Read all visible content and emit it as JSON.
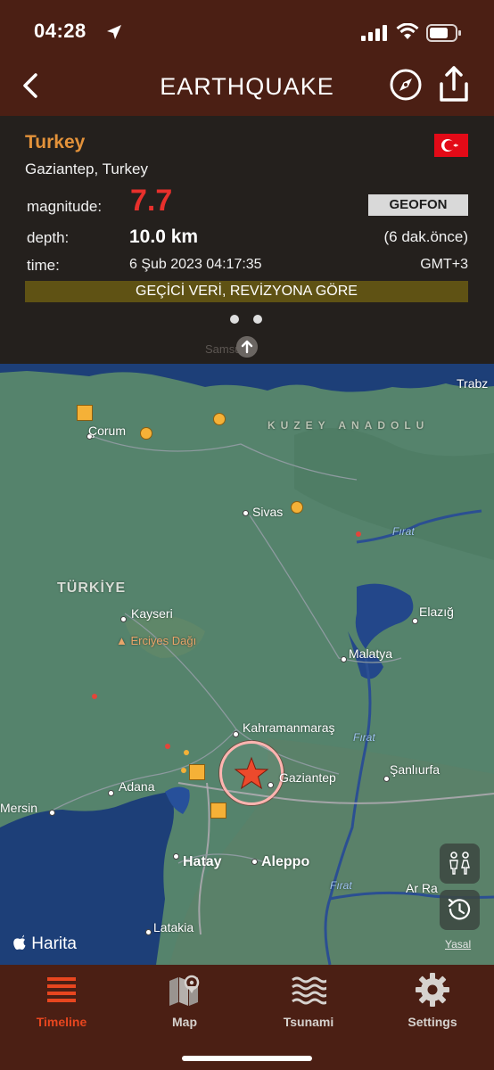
{
  "status": {
    "time": "04:28"
  },
  "nav": {
    "title": "EARTHQUAKE"
  },
  "event": {
    "country": "Turkey",
    "region": "Gaziantep, Turkey",
    "magnitude_label": "magnitude:",
    "magnitude": "7.7",
    "source": "GEOFON",
    "depth_label": "depth:",
    "depth": "10.0 km",
    "ago": "(6 dak.önce)",
    "time_label": "time:",
    "time": "6 Şub 2023 04:17:35",
    "timezone": "GMT+3",
    "notice": "GEÇİCİ VERİ, REVİZYONA GÖRE",
    "page_count": 2,
    "current_page": 1,
    "flag_colors": {
      "red": "#e30a17",
      "white": "#ffffff"
    }
  },
  "map": {
    "labels": {
      "samsun": "Samsun",
      "trabzon": "Trabz",
      "corum": "Çorum",
      "kuzey_anadolu": "KUZEY ANADOLU",
      "sivas": "Sivas",
      "firat1": "Fırat",
      "turkiye": "TÜRKİYE",
      "kayseri": "Kayseri",
      "elazig": "Elazığ",
      "erciyes": "Erciyes Dağı",
      "malatya": "Malatya",
      "kahramanmaras": "Kahramanmaraş",
      "firat2": "Fırat",
      "sanliurfa": "Şanlıurfa",
      "adana": "Adana",
      "gaziantep": "Gaziantep",
      "mersin": "Mersin",
      "hatay": "Hatay",
      "aleppo": "Aleppo",
      "firat3": "Fırat",
      "ar_raqqa": "Ar Ra",
      "latakia": "Latakia"
    },
    "attribution": "Harita",
    "legal": "Yasal"
  },
  "tabs": [
    {
      "label": "Timeline",
      "icon": "list-icon",
      "active": true
    },
    {
      "label": "Map",
      "icon": "map-icon",
      "active": false
    },
    {
      "label": "Tsunami",
      "icon": "waves-icon",
      "active": false
    },
    {
      "label": "Settings",
      "icon": "gear-icon",
      "active": false
    }
  ],
  "colors": {
    "header_bg": "#4b1f14",
    "card_bg": "#24201d",
    "country": "#e3923a",
    "magnitude": "#e8302c",
    "notice_bg": "#5f5214",
    "active_tab": "#e8461f",
    "marker": "#f5b137"
  }
}
